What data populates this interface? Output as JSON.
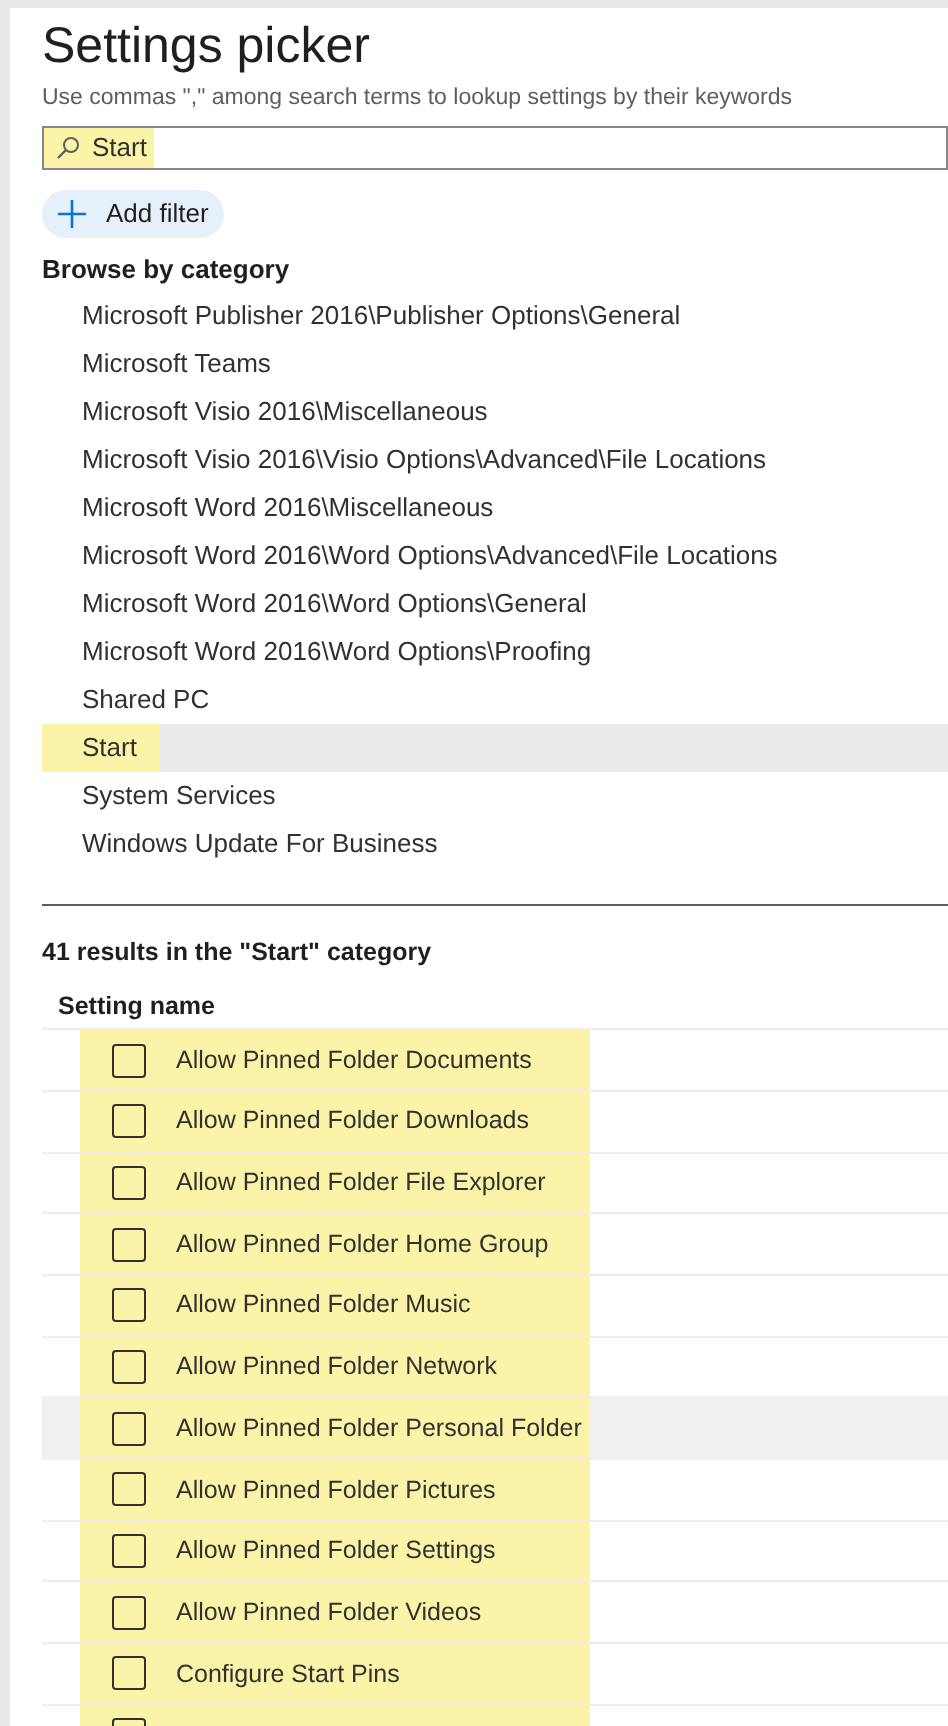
{
  "title": "Settings picker",
  "subtitle": "Use commas \",\" among search terms to lookup settings by their keywords",
  "search": {
    "value": "Start",
    "highlighted": true
  },
  "add_filter": {
    "label": "Add filter"
  },
  "browse": {
    "heading": "Browse by category",
    "items": [
      {
        "label": "Microsoft Publisher 2016\\Publisher Options\\General",
        "selected": false,
        "highlighted": false
      },
      {
        "label": "Microsoft Teams",
        "selected": false,
        "highlighted": false
      },
      {
        "label": "Microsoft Visio 2016\\Miscellaneous",
        "selected": false,
        "highlighted": false
      },
      {
        "label": "Microsoft Visio 2016\\Visio Options\\Advanced\\File Locations",
        "selected": false,
        "highlighted": false
      },
      {
        "label": "Microsoft Word 2016\\Miscellaneous",
        "selected": false,
        "highlighted": false
      },
      {
        "label": "Microsoft Word 2016\\Word Options\\Advanced\\File Locations",
        "selected": false,
        "highlighted": false
      },
      {
        "label": "Microsoft Word 2016\\Word Options\\General",
        "selected": false,
        "highlighted": false
      },
      {
        "label": "Microsoft Word 2016\\Word Options\\Proofing",
        "selected": false,
        "highlighted": false
      },
      {
        "label": "Shared PC",
        "selected": false,
        "highlighted": false
      },
      {
        "label": "Start",
        "selected": true,
        "highlighted": true
      },
      {
        "label": "System Services",
        "selected": false,
        "highlighted": false
      },
      {
        "label": "Windows Update For Business",
        "selected": false,
        "highlighted": false
      }
    ]
  },
  "results": {
    "summary": "41 results in the \"Start\" category",
    "column": "Setting name",
    "rows": [
      {
        "label": "Allow Pinned Folder Documents",
        "checked": false,
        "hovered": false,
        "highlighted": true
      },
      {
        "label": "Allow Pinned Folder Downloads",
        "checked": false,
        "hovered": false,
        "highlighted": true
      },
      {
        "label": "Allow Pinned Folder File Explorer",
        "checked": false,
        "hovered": false,
        "highlighted": true
      },
      {
        "label": "Allow Pinned Folder Home Group",
        "checked": false,
        "hovered": false,
        "highlighted": true
      },
      {
        "label": "Allow Pinned Folder Music",
        "checked": false,
        "hovered": false,
        "highlighted": true
      },
      {
        "label": "Allow Pinned Folder Network",
        "checked": false,
        "hovered": false,
        "highlighted": true
      },
      {
        "label": "Allow Pinned Folder Personal Folder",
        "checked": false,
        "hovered": true,
        "highlighted": true
      },
      {
        "label": "Allow Pinned Folder Pictures",
        "checked": false,
        "hovered": false,
        "highlighted": true
      },
      {
        "label": "Allow Pinned Folder Settings",
        "checked": false,
        "hovered": false,
        "highlighted": true
      },
      {
        "label": "Allow Pinned Folder Videos",
        "checked": false,
        "hovered": false,
        "highlighted": true
      },
      {
        "label": "Configure Start Pins",
        "checked": false,
        "hovered": false,
        "highlighted": true
      },
      {
        "checked": false,
        "hovered": false,
        "highlighted": true
      }
    ]
  }
}
